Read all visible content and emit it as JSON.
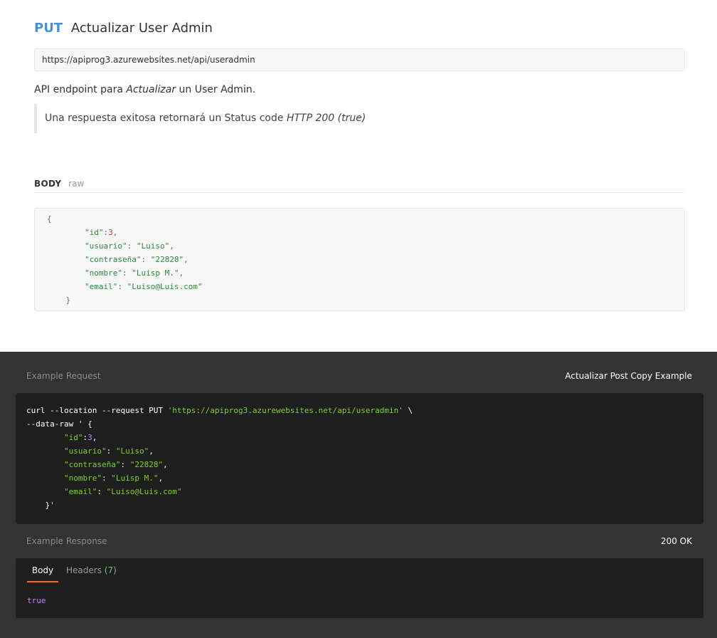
{
  "request": {
    "method": "PUT",
    "name": "Actualizar User Admin",
    "url": "https://apiprog3.azurewebsites.net/api/useradmin",
    "description": {
      "before": "API endpoint para ",
      "emphasis": "Actualizar",
      "after": " un User Admin."
    },
    "note": {
      "before": "Una respuesta exitosa retornará un Status code ",
      "emphasis": "HTTP 200 (true)"
    }
  },
  "body_section": {
    "label": "BODY",
    "mode": "raw",
    "lines": [
      {
        "indent": "",
        "parts": [
          {
            "t": "{",
            "c": "p-light"
          }
        ]
      },
      {
        "indent": "        ",
        "parts": [
          {
            "t": "\"id\"",
            "c": "k-light"
          },
          {
            "t": ":",
            "c": "p-light"
          },
          {
            "t": "3",
            "c": "n-light"
          },
          {
            "t": ",",
            "c": "p-light"
          }
        ]
      },
      {
        "indent": "        ",
        "parts": [
          {
            "t": "\"usuario\"",
            "c": "k-light"
          },
          {
            "t": ": ",
            "c": "p-light"
          },
          {
            "t": "\"Luiso\"",
            "c": "s-light"
          },
          {
            "t": ",",
            "c": "p-light"
          }
        ]
      },
      {
        "indent": "        ",
        "parts": [
          {
            "t": "\"contraseña\"",
            "c": "k-light"
          },
          {
            "t": ": ",
            "c": "p-light"
          },
          {
            "t": "\"22828\"",
            "c": "s-light"
          },
          {
            "t": ",",
            "c": "p-light"
          }
        ]
      },
      {
        "indent": "        ",
        "parts": [
          {
            "t": "\"nombre\"",
            "c": "k-light"
          },
          {
            "t": ": ",
            "c": "p-light"
          },
          {
            "t": "\"Luisp M.\"",
            "c": "s-light"
          },
          {
            "t": ",",
            "c": "p-light"
          }
        ]
      },
      {
        "indent": "        ",
        "parts": [
          {
            "t": "\"email\"",
            "c": "k-light"
          },
          {
            "t": ": ",
            "c": "p-light"
          },
          {
            "t": "\"Luiso@Luis.com\"",
            "c": "s-light"
          }
        ]
      },
      {
        "indent": "    ",
        "parts": [
          {
            "t": "}",
            "c": "p-light"
          }
        ]
      }
    ]
  },
  "example_request": {
    "label": "Example Request",
    "selector": "Actualizar Post Copy Example",
    "lines": [
      {
        "parts": [
          {
            "t": "curl --location --request PUT ",
            "c": "c-w"
          },
          {
            "t": "'https://apiprog3.azurewebsites.net/api/useradmin'",
            "c": "c-str"
          },
          {
            "t": " \\",
            "c": "c-w"
          }
        ]
      },
      {
        "parts": [
          {
            "t": "--data-raw ",
            "c": "c-w"
          },
          {
            "t": "' {",
            "c": "c-w"
          }
        ]
      },
      {
        "parts": [
          {
            "t": "        ",
            "c": "c-w"
          },
          {
            "t": "\"id\"",
            "c": "c-str"
          },
          {
            "t": ":",
            "c": "c-w"
          },
          {
            "t": "3",
            "c": "c-num"
          },
          {
            "t": ",",
            "c": "c-w"
          }
        ]
      },
      {
        "parts": [
          {
            "t": "        ",
            "c": "c-w"
          },
          {
            "t": "\"usuario\"",
            "c": "c-str"
          },
          {
            "t": ": ",
            "c": "c-w"
          },
          {
            "t": "\"Luiso\"",
            "c": "c-str"
          },
          {
            "t": ",",
            "c": "c-w"
          }
        ]
      },
      {
        "parts": [
          {
            "t": "        ",
            "c": "c-w"
          },
          {
            "t": "\"contraseña\"",
            "c": "c-str"
          },
          {
            "t": ": ",
            "c": "c-w"
          },
          {
            "t": "\"22828\"",
            "c": "c-str"
          },
          {
            "t": ",",
            "c": "c-w"
          }
        ]
      },
      {
        "parts": [
          {
            "t": "        ",
            "c": "c-w"
          },
          {
            "t": "\"nombre\"",
            "c": "c-str"
          },
          {
            "t": ": ",
            "c": "c-w"
          },
          {
            "t": "\"Luisp M.\"",
            "c": "c-str"
          },
          {
            "t": ",",
            "c": "c-w"
          }
        ]
      },
      {
        "parts": [
          {
            "t": "        ",
            "c": "c-w"
          },
          {
            "t": "\"email\"",
            "c": "c-str"
          },
          {
            "t": ": ",
            "c": "c-w"
          },
          {
            "t": "\"Luiso@Luis.com\"",
            "c": "c-str"
          }
        ]
      },
      {
        "parts": [
          {
            "t": "    }'",
            "c": "c-w"
          }
        ]
      }
    ]
  },
  "example_response": {
    "label": "Example Response",
    "status": "200 OK",
    "tabs": {
      "body": "Body",
      "headers": "Headers",
      "headers_count": "(7)"
    },
    "value": "true"
  },
  "colors": {
    "method": "#4a90d9",
    "dark_bg": "#333333",
    "code_bg": "#1e1e1e",
    "active_tab": "#f26b3a",
    "string_dark": "#7ed321",
    "number_dark": "#c77dff"
  }
}
